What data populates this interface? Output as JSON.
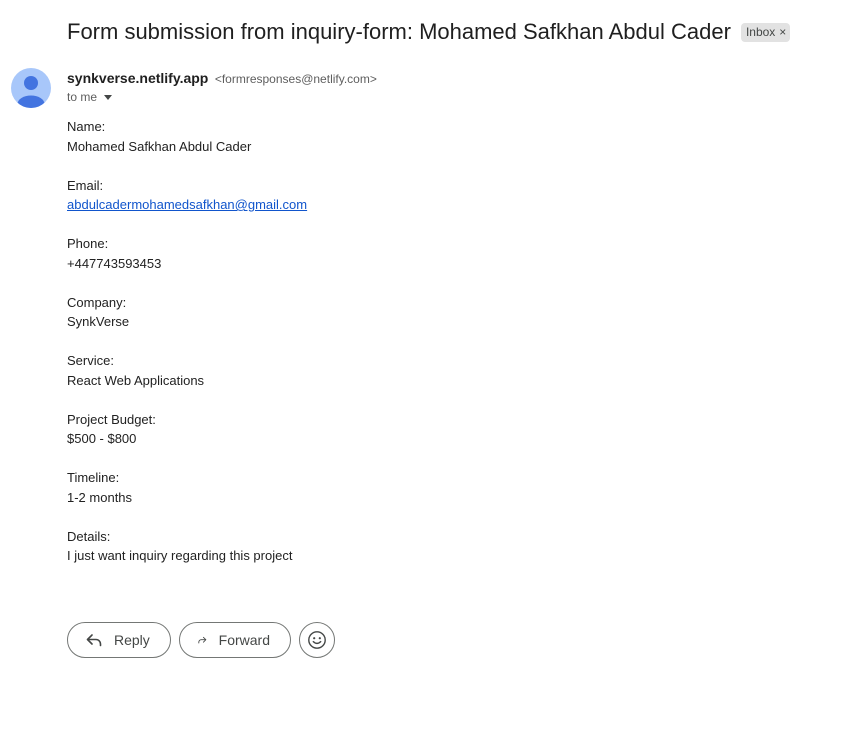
{
  "email": {
    "subject": "Form submission from inquiry-form: Mohamed Safkhan Abdul Cader",
    "label": "Inbox",
    "label_remove": "×",
    "sender_name": "synkverse.netlify.app",
    "sender_email": "<formresponses@netlify.com>",
    "recipient": "to me"
  },
  "fields": [
    {
      "label": "Name:",
      "value": "Mohamed Safkhan Abdul Cader"
    },
    {
      "label": "Email:",
      "value": "abdulcadermohamedsafkhan@gmail.com"
    },
    {
      "label": "Phone:",
      "value": "+447743593453"
    },
    {
      "label": "Company:",
      "value": "SynkVerse"
    },
    {
      "label": "Service:",
      "value": "React Web Applications"
    },
    {
      "label": "Project Budget:",
      "value": "$500 - $800"
    },
    {
      "label": "Timeline:",
      "value": "1-2 months"
    },
    {
      "label": "Details:",
      "value": "I just want inquiry regarding this project"
    }
  ],
  "actions": {
    "reply": "Reply",
    "forward": "Forward"
  },
  "icons": {
    "avatar": "person-icon",
    "reply": "reply-arrow-icon",
    "forward": "forward-arrow-icon",
    "emoji": "smiley-icon"
  },
  "colors": {
    "link": "#1155cc",
    "avatar_bg": "#a8c7fa",
    "avatar_fg": "#4374e0",
    "chip_bg": "#e2e2e2"
  }
}
